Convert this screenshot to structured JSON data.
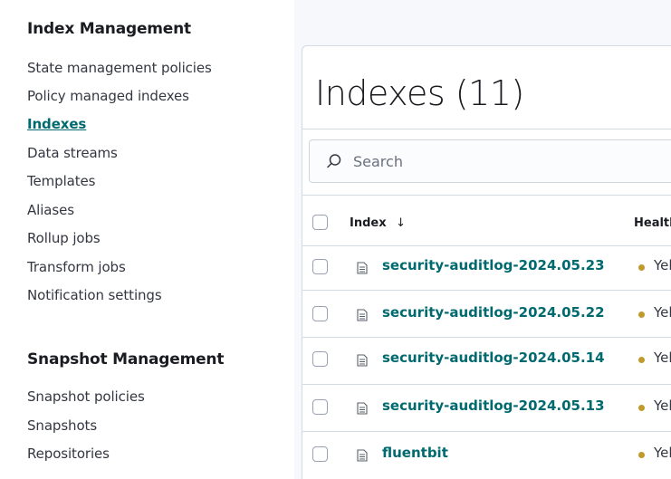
{
  "sidebar": {
    "index_management_title": "Index Management",
    "index_items": [
      {
        "label": "State management policies"
      },
      {
        "label": "Policy managed indexes"
      },
      {
        "label": "Indexes",
        "active": true
      },
      {
        "label": "Data streams"
      },
      {
        "label": "Templates"
      },
      {
        "label": "Aliases"
      },
      {
        "label": "Rollup jobs"
      },
      {
        "label": "Transform jobs"
      },
      {
        "label": "Notification settings"
      }
    ],
    "snapshot_management_title": "Snapshot Management",
    "snapshot_items": [
      {
        "label": "Snapshot policies"
      },
      {
        "label": "Snapshots"
      },
      {
        "label": "Repositories"
      }
    ]
  },
  "main": {
    "title": "Indexes (11)",
    "search": {
      "placeholder": "Search",
      "icon": "search-icon"
    },
    "table": {
      "columns": {
        "index": "Index",
        "index_sort_icon": "arrow-down-icon",
        "health": "Health"
      },
      "rows": [
        {
          "name": "security-auditlog-2024.05.23",
          "health": "Yellow"
        },
        {
          "name": "security-auditlog-2024.05.22",
          "health": "Yellow"
        },
        {
          "name": "security-auditlog-2024.05.14",
          "health": "Yellow"
        },
        {
          "name": "security-auditlog-2024.05.13",
          "health": "Yellow"
        },
        {
          "name": "fluentbit",
          "health": "Yellow"
        }
      ]
    }
  },
  "colors": {
    "link": "#006a6e",
    "health_yellow": "#c09a2a",
    "title": "#1a1c21",
    "border": "#d3dae6"
  }
}
